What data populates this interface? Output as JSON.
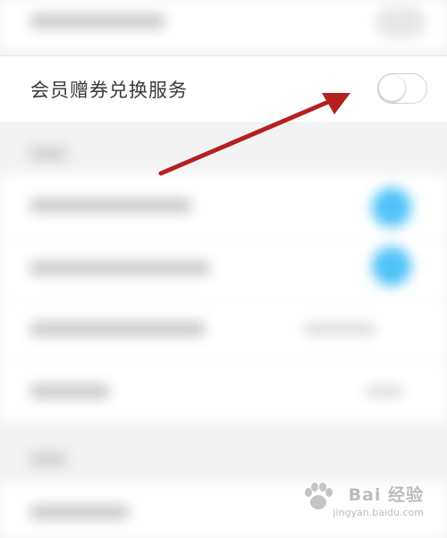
{
  "settings": {
    "exchange_row": {
      "label": "会员赠券兑换服务",
      "toggle_on": false
    }
  },
  "watermark": {
    "main": "Bai 经验",
    "sub": "jingyan.baidu.com"
  },
  "colors": {
    "arrow": "#b52020",
    "toggle_border": "#d2d2d2",
    "accent_blurred": "#4fc3f7"
  }
}
